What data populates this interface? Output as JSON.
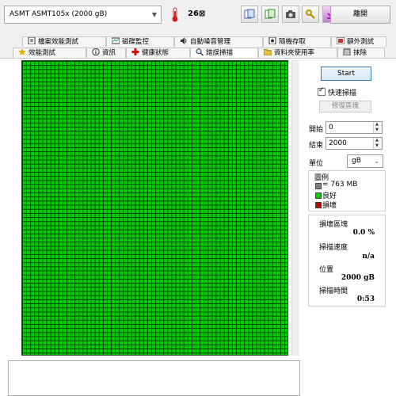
{
  "toolbar": {
    "drive": "ASMT   ASMT105x (2000 gB)",
    "temperature": "26",
    "temperature_unit": "⊠",
    "exit_label": "離開",
    "icons": [
      "copy-info-icon",
      "copy-text-icon",
      "screenshot-icon",
      "options-icon",
      "save-icon"
    ]
  },
  "tabs_top": [
    {
      "label": "檔案效能測試",
      "icon": "file-benchmark-icon"
    },
    {
      "label": "磁碟監控",
      "icon": "disk-monitor-icon"
    },
    {
      "label": "自動噪音管理",
      "icon": "speaker-icon"
    },
    {
      "label": "隨機存取",
      "icon": "random-access-icon"
    },
    {
      "label": "額外測試",
      "icon": "extra-tests-icon"
    }
  ],
  "tabs_bottom": [
    {
      "label": "效能測試",
      "icon": "benchmark-icon"
    },
    {
      "label": "資訊",
      "icon": "info-icon"
    },
    {
      "label": "健康狀態",
      "icon": "health-icon"
    },
    {
      "label": "錯誤掃描",
      "icon": "magnifier-icon",
      "active": true
    },
    {
      "label": "資料夾使用率",
      "icon": "folder-icon"
    },
    {
      "label": "抹除",
      "icon": "erase-icon"
    }
  ],
  "controls": {
    "start_label": "Start",
    "quick_scan_label": "快速掃描",
    "quick_scan_checked": true,
    "repair_label": "修復區塊",
    "start_field_label": "開始",
    "start_value": "0",
    "end_field_label": "結束",
    "end_value": "2000",
    "unit_label": "單位",
    "unit_value": "gB"
  },
  "legend": {
    "title": "圖例",
    "block_size": "= 763 MB",
    "good": "良好",
    "damaged": "損壞",
    "colors": {
      "block": "#808080",
      "good": "#00d000",
      "damaged": "#c00000"
    }
  },
  "stats": {
    "damaged_blocks_label": "損壞區塊",
    "damaged_blocks_value": "0.0 %",
    "scan_speed_label": "掃描速度",
    "scan_speed_value": "n/a",
    "position_label": "位置",
    "position_value": "2000 gB",
    "elapsed_label": "掃描時間",
    "elapsed_value": "0:53"
  },
  "scan_grid": {
    "status": "all-good",
    "color_good": "#00d000"
  }
}
